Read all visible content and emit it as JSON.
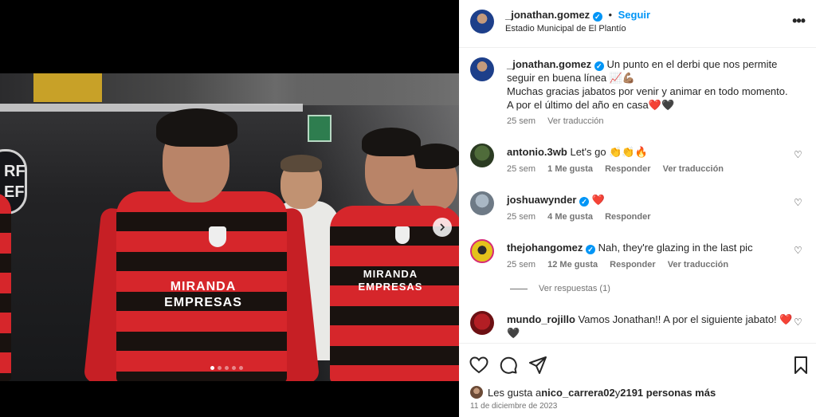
{
  "post": {
    "username": "_jonathan.gomez",
    "follow_label": "Seguir",
    "location": "Estadio Municipal de El Plantío",
    "more_icon": "more-options-icon",
    "caption": {
      "username": "_jonathan.gomez",
      "text_line1": "Un punto en el derbi que nos permite seguir en buena línea 📈💪🏽",
      "text_line2": "Muchas gracias jabatos por venir y animar en todo momento. A por el último del año en casa❤️🖤",
      "time": "25 sem",
      "translate": "Ver traducción"
    }
  },
  "image": {
    "shirt_brand_line1": "MIRANDA",
    "shirt_brand_line2": "EMPRESAS",
    "badge_text": "RF\nEF",
    "carousel_count": 5,
    "carousel_active": 1
  },
  "comments": [
    {
      "username": "antonio.3wb",
      "text": "Let's go 👏👏🔥",
      "time": "25 sem",
      "likes": "1 Me gusta",
      "reply": "Responder",
      "translate": "Ver traducción"
    },
    {
      "username": "joshuawynder",
      "verified": true,
      "text": "❤️",
      "time": "25 sem",
      "likes": "4 Me gusta",
      "reply": "Responder"
    },
    {
      "username": "thejohangomez",
      "verified": true,
      "text": "Nah, they're glazing in the last pic",
      "time": "25 sem",
      "likes": "12 Me gusta",
      "reply": "Responder",
      "translate": "Ver traducción",
      "view_replies": "Ver respuestas (1)"
    },
    {
      "username": "mundo_rojillo",
      "text": "Vamos Jonathan!! A por el siguiente jabato! ❤️",
      "text2": "🖤"
    }
  ],
  "footer": {
    "likes_prefix": "Les gusta a ",
    "likes_user": "nico_carrera02",
    "likes_middle": " y ",
    "likes_count": "2191 personas más",
    "date": "11 de diciembre de 2023"
  },
  "colors": {
    "accent": "#0095f6",
    "text": "#262626",
    "muted": "#737373",
    "heart_red": "#ff3040"
  }
}
